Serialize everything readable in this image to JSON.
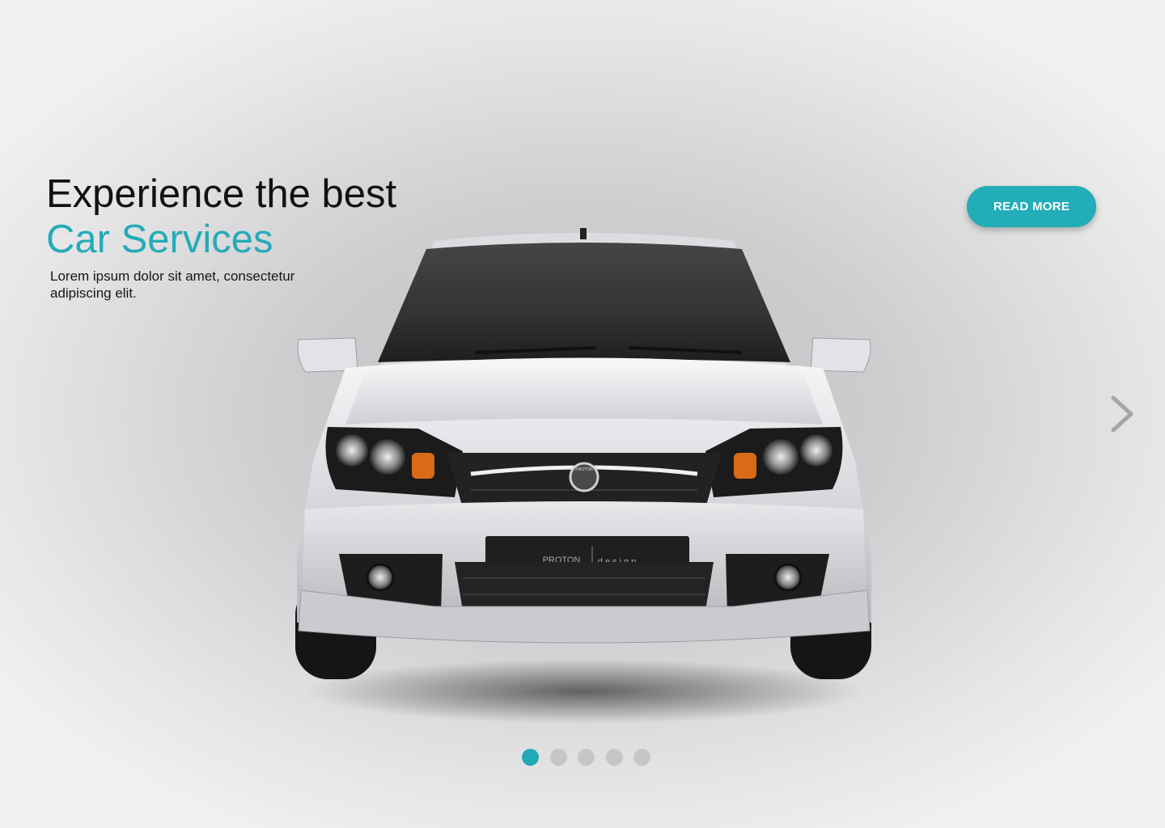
{
  "hero": {
    "heading_line1": "Experience the best",
    "heading_line2": "Car Services",
    "description": "Lorem ipsum dolor sit amet, consectetur adipiscing elit.",
    "read_more_label": "READ MORE"
  },
  "car": {
    "plate_brand": "PROTON",
    "plate_suffix": "design",
    "badge_text": "PROTON"
  },
  "carousel": {
    "slide_count": 5,
    "active_index": 0,
    "next_icon": "chevron-right-icon"
  },
  "colors": {
    "accent": "#25abb7",
    "heading": "#111111",
    "dot_inactive": "#c6c6c8",
    "background": "#d4d4d6"
  }
}
